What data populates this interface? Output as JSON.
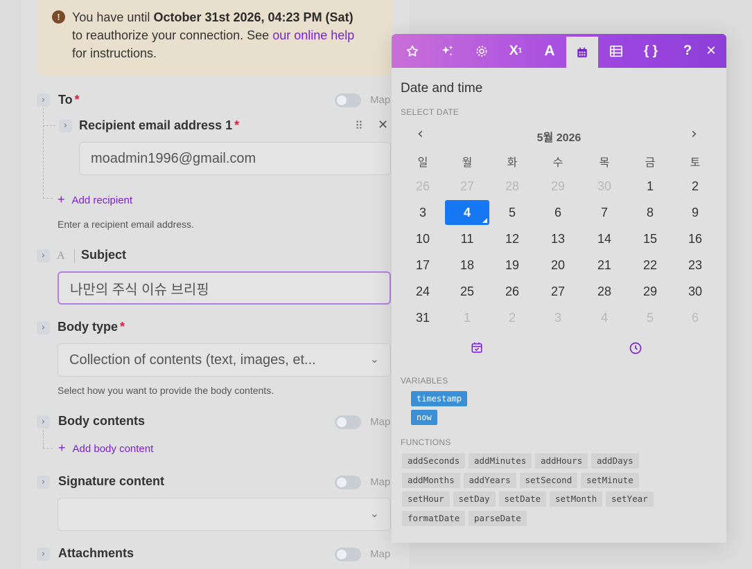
{
  "notice": {
    "prefix": "You have until ",
    "deadline": "October 31st 2026, 04:23 PM (Sat)",
    "middle": "to reauthorize your connection. See ",
    "link": "our online help",
    "suffix": "for instructions."
  },
  "fields": {
    "to": {
      "label": "To",
      "required": "*",
      "map": "Map"
    },
    "recipient": {
      "label": "Recipient email address 1",
      "required": "*",
      "value": "moadmin1996@gmail.com"
    },
    "add_recipient": "Add recipient",
    "to_hint": "Enter a recipient email address.",
    "subject": {
      "type_icon": "A",
      "label": "Subject",
      "value": "나만의 주식 이슈 브리핑"
    },
    "body_type": {
      "label": "Body type",
      "required": "*",
      "value": "Collection of contents (text, images, et...",
      "hint": "Select how you want to provide the body contents."
    },
    "body_contents": {
      "label": "Body contents",
      "map": "Map"
    },
    "add_body": "Add body content",
    "signature": {
      "label": "Signature content",
      "map": "Map",
      "value": ""
    },
    "attachments": {
      "label": "Attachments",
      "map": "Map"
    }
  },
  "picker": {
    "toolbar": [
      "star-icon",
      "sparkles-icon",
      "gear-icon",
      "superscript-icon",
      "text-icon",
      "calendar-icon",
      "table-icon",
      "braces-icon",
      "help-icon",
      "close-icon"
    ],
    "title": "Date and time",
    "select_date_label": "SELECT DATE",
    "month": "5월 2026",
    "weekdays": [
      "일",
      "월",
      "화",
      "수",
      "목",
      "금",
      "토"
    ],
    "weeks": [
      [
        "26",
        "27",
        "28",
        "29",
        "30",
        "1",
        "2"
      ],
      [
        "3",
        "4",
        "5",
        "6",
        "7",
        "8",
        "9"
      ],
      [
        "10",
        "11",
        "12",
        "13",
        "14",
        "15",
        "16"
      ],
      [
        "17",
        "18",
        "19",
        "20",
        "21",
        "22",
        "23"
      ],
      [
        "24",
        "25",
        "26",
        "27",
        "28",
        "29",
        "30"
      ],
      [
        "31",
        "1",
        "2",
        "3",
        "4",
        "5",
        "6"
      ]
    ],
    "selected_day": "4",
    "variables_label": "VARIABLES",
    "variables": [
      "timestamp",
      "now"
    ],
    "functions_label": "FUNCTIONS",
    "functions": [
      [
        "addSeconds",
        "addMinutes",
        "addHours",
        "addDays"
      ],
      [
        "addMonths",
        "addYears",
        "setSecond",
        "setMinute"
      ],
      [
        "setHour",
        "setDay",
        "setDate",
        "setMonth",
        "setYear"
      ],
      [
        "formatDate",
        "parseDate"
      ]
    ],
    "accent": "#7a1fd6",
    "selected_color": "#1677f2"
  }
}
